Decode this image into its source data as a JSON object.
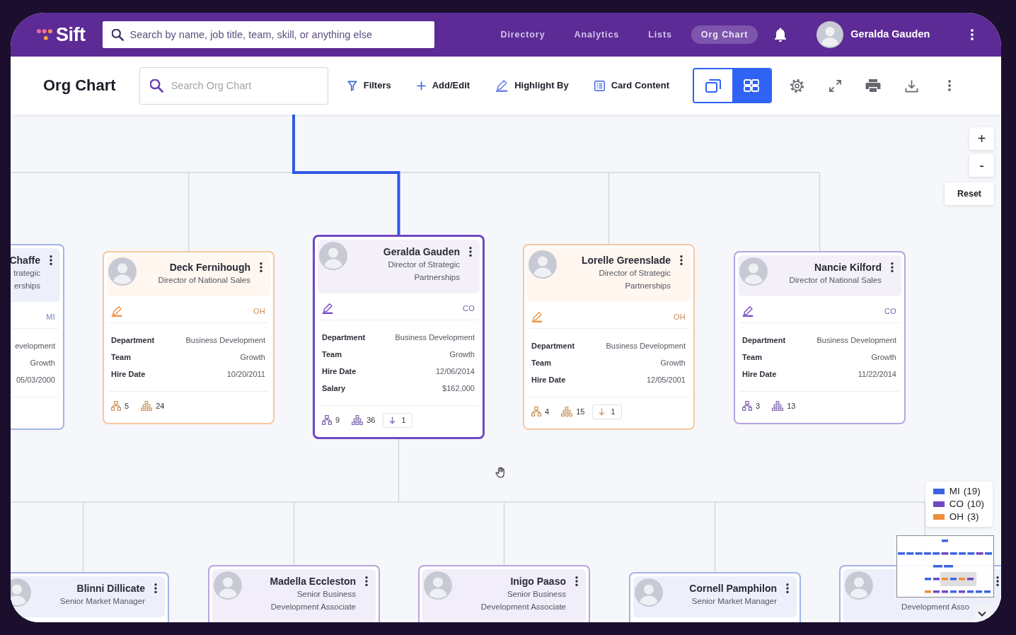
{
  "topbar": {
    "logo": "Sift",
    "search": {
      "placeholder": "Search by name, job title, team, skill, or anything else"
    },
    "nav": [
      {
        "label": "Directory",
        "selected": false
      },
      {
        "label": "Analytics",
        "selected": false
      },
      {
        "label": "Lists",
        "selected": false
      },
      {
        "label": "Org Chart",
        "selected": true
      }
    ],
    "user": {
      "name": "Geralda Gauden"
    }
  },
  "toolbar": {
    "title": "Org Chart",
    "search": {
      "placeholder": "Search Org Chart"
    },
    "actions": [
      {
        "label": "Filters"
      },
      {
        "label": "Add/Edit"
      },
      {
        "label": "Highlight By"
      },
      {
        "label": "Card Content"
      }
    ],
    "view_toggle": [
      {
        "selected": false
      },
      {
        "selected": true
      }
    ]
  },
  "zoom_controls": [
    {
      "label": "+"
    },
    {
      "label": "-"
    },
    {
      "label": "Reset"
    }
  ],
  "clipped_manager": {
    "name": "Chaffe",
    "title": "trategic\nerships",
    "tag": "MI",
    "color": "#a3b4e8",
    "values": [
      "evelopment",
      "Growth",
      "05/03/2000"
    ]
  },
  "managers": [
    {
      "name": "Deck Fernihough",
      "title": "Director of National Sales",
      "tag": "OH",
      "color": "#ee8f3a",
      "selected": false,
      "fields": [
        {
          "label": "Department",
          "value": "Business Development"
        },
        {
          "label": "Team",
          "value": "Growth"
        },
        {
          "label": "Hire Date",
          "value": "10/20/2011"
        }
      ],
      "direct_reports": "5",
      "total_reports": "24"
    },
    {
      "name": "Geralda Gauden",
      "title": "Director of Strategic Partnerships",
      "tag": "CO",
      "color": "#7048c0",
      "selected": true,
      "fields": [
        {
          "label": "Department",
          "value": "Business Development"
        },
        {
          "label": "Team",
          "value": "Growth"
        },
        {
          "label": "Hire Date",
          "value": "12/06/2014"
        },
        {
          "label": "Salary",
          "value": "$162,000"
        }
      ],
      "direct_reports": "9",
      "total_reports": "36",
      "pending": "1"
    },
    {
      "name": "Lorelle Greenslade",
      "title": "Director of Strategic Partnerships",
      "tag": "OH",
      "color": "#ee8f3a",
      "selected": false,
      "fields": [
        {
          "label": "Department",
          "value": "Business Development"
        },
        {
          "label": "Team",
          "value": "Growth"
        },
        {
          "label": "Hire Date",
          "value": "12/05/2001"
        }
      ],
      "direct_reports": "4",
      "total_reports": "15",
      "pending": "1"
    },
    {
      "name": "Nancie Kilford",
      "title": "Director of National Sales",
      "tag": "CO",
      "color": "#7048c0",
      "selected": false,
      "fields": [
        {
          "label": "Department",
          "value": "Business Development"
        },
        {
          "label": "Team",
          "value": "Growth"
        },
        {
          "label": "Hire Date",
          "value": "11/22/2014"
        }
      ],
      "direct_reports": "3",
      "total_reports": "13"
    }
  ],
  "reports": [
    {
      "name": "Blinni Dillicate",
      "title": "Senior Market Manager",
      "color": "#a3b4e8"
    },
    {
      "name": "Madella Eccleston",
      "title": "Senior Business Development Associate",
      "color": "#b9a5df"
    },
    {
      "name": "Inigo Paaso",
      "title": "Senior Business Development Associate",
      "color": "#b9a5df"
    },
    {
      "name": "Cornell Pamphilon",
      "title": "Senior Market Manager",
      "color": "#a3b4e8"
    },
    {
      "title": "Development Asso",
      "color": "#a3b4e8"
    }
  ],
  "legend": [
    {
      "label": "MI",
      "count": "(19)",
      "color": "#3c64e0"
    },
    {
      "label": "CO",
      "count": "(10)",
      "color": "#7048c0"
    },
    {
      "label": "OH",
      "count": "(3)",
      "color": "#ee8f3a"
    }
  ]
}
